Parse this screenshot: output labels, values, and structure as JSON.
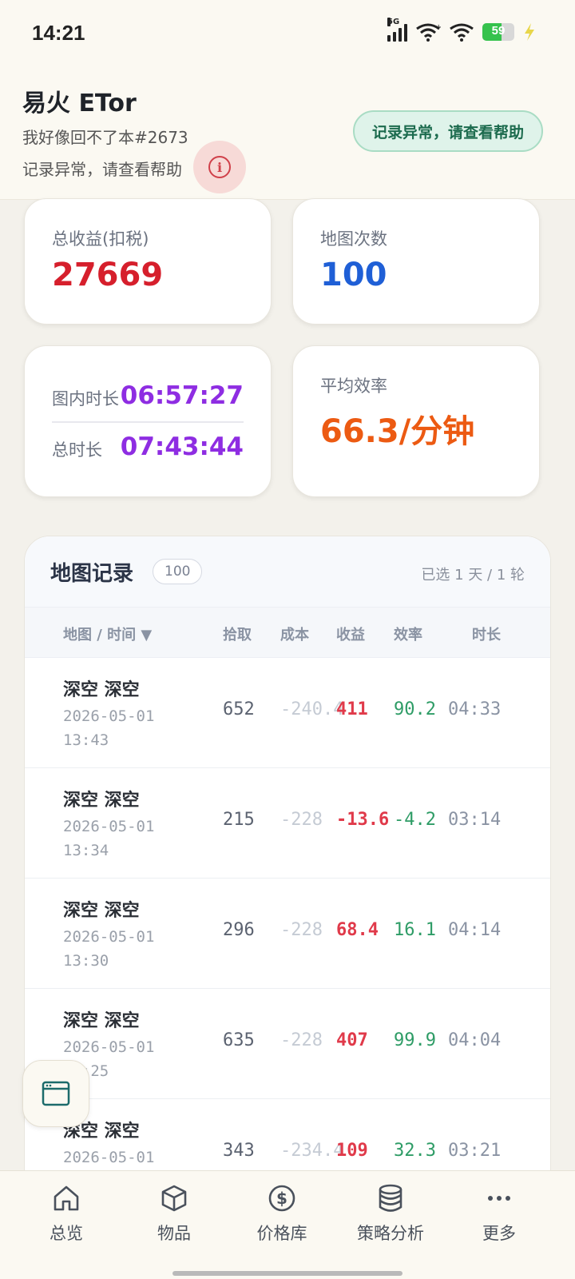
{
  "status": {
    "time": "14:21",
    "network": "5G",
    "battery": "59",
    "battery_level": 0.59
  },
  "header": {
    "title": "易火 ETor",
    "subtitle": "我好像回不了本#2673",
    "warning": "记录异常，请查看帮助",
    "help_button": "记录异常，请查看帮助"
  },
  "stats": {
    "total_profit_label": "总收益(扣税)",
    "total_profit_value": "27669",
    "map_count_label": "地图次数",
    "map_count_value": "100",
    "in_map_time_label": "图内时长",
    "in_map_time_value": "06:57:27",
    "total_time_label": "总时长",
    "total_time_value": "07:43:44",
    "avg_eff_label": "平均效率",
    "avg_eff_value": "66.3/分钟"
  },
  "records": {
    "title": "地图记录",
    "count": "100",
    "selection": "已选 1 天 / 1 轮",
    "columns": {
      "map": "地图 / 时间 ▼",
      "pick": "拾取",
      "cost": "成本",
      "profit": "收益",
      "eff": "效率",
      "dur": "时长"
    },
    "rows": [
      {
        "map": "深空 深空",
        "date": "2026-05-01 13:43",
        "pick": "652",
        "cost": "-240.4",
        "profit": "411",
        "eff": "90.2",
        "dur": "04:33"
      },
      {
        "map": "深空 深空",
        "date": "2026-05-01 13:34",
        "pick": "215",
        "cost": "-228",
        "profit": "-13.6",
        "eff": "-4.2",
        "dur": "03:14"
      },
      {
        "map": "深空 深空",
        "date": "2026-05-01 13:30",
        "pick": "296",
        "cost": "-228",
        "profit": "68.4",
        "eff": "16.1",
        "dur": "04:14"
      },
      {
        "map": "深空 深空",
        "date": "2026-05-01 13:25",
        "pick": "635",
        "cost": "-228",
        "profit": "407",
        "eff": "99.9",
        "dur": "04:04"
      },
      {
        "map": "深空 深空",
        "date": "2026-05-01",
        "pick": "343",
        "cost": "-234.4",
        "profit": "109",
        "eff": "32.3",
        "dur": "03:21"
      }
    ]
  },
  "nav": [
    {
      "label": "总览",
      "icon": "home-icon"
    },
    {
      "label": "物品",
      "icon": "cube-icon"
    },
    {
      "label": "价格库",
      "icon": "dollar-icon"
    },
    {
      "label": "策略分析",
      "icon": "database-icon"
    },
    {
      "label": "更多",
      "icon": "more-icon"
    }
  ],
  "colors": {
    "profit_red": "#e03a4a",
    "map_blue": "#1f5fd6",
    "time_purple": "#8e2de2",
    "eff_orange": "#ec5a12",
    "eff_green": "#2e9c66"
  }
}
